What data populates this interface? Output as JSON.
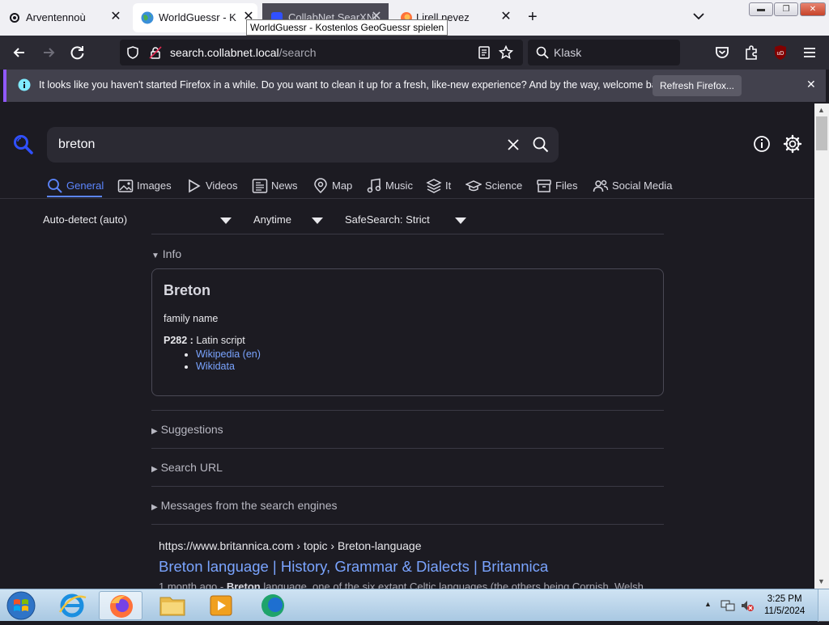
{
  "browser": {
    "tabs": [
      {
        "title": "Arventennoù",
        "icon": "gear-icon"
      },
      {
        "title": "WorldGuessr - Kost",
        "icon": "globe-icon"
      },
      {
        "title": "CollabNet SearXNG",
        "icon": "searxng-icon"
      },
      {
        "title": "Lirell nevez",
        "icon": "firefox-icon"
      }
    ],
    "tooltip": "WorldGuessr - Kostenlos GeoGuessr spielen",
    "url_host": "search.collabnet.local",
    "url_path": "/search",
    "search_placeholder": "Klask",
    "notification": {
      "message": "It looks like you haven't started Firefox in a while. Do you want to clean it up for a fresh, like-new experience? And by the way, welcome back!",
      "button": "Refresh Firefox..."
    }
  },
  "search": {
    "query": "breton",
    "categories": [
      "General",
      "Images",
      "Videos",
      "News",
      "Map",
      "Music",
      "It",
      "Science",
      "Files",
      "Social Media"
    ],
    "active_category": "General",
    "filters": {
      "language": "Auto-detect (auto)",
      "time": "Anytime",
      "safesearch": "SafeSearch: Strict"
    }
  },
  "infobox": {
    "section": "Info",
    "title": "Breton",
    "subtitle": "family name",
    "property_key": "P282 :",
    "property_value": "Latin script",
    "links": [
      "Wikipedia (en)",
      "Wikidata"
    ]
  },
  "sections": [
    "Suggestions",
    "Search URL",
    "Messages from the search engines"
  ],
  "result": {
    "url": "https://www.britannica.com",
    "breadcrumb": "› topic › Breton-language",
    "title": "Breton language | History, Grammar & Dialects | Britannica",
    "snippet_prefix": "1 month ago - ",
    "snippet_bold": "Breton",
    "snippet_rest": " language, one of the six extant Celtic languages (the others being Cornish, Welsh,"
  },
  "taskbar": {
    "time": "3:25 PM",
    "date": "11/5/2024"
  }
}
